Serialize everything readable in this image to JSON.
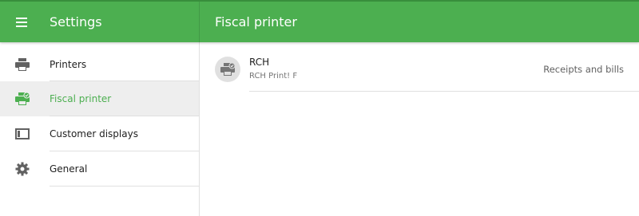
{
  "header": {
    "app_title": "Settings",
    "page_title": "Fiscal printer",
    "menu_icon": "menu-icon",
    "accent_color": "#4caf50"
  },
  "sidebar": {
    "items": [
      {
        "label": "Printers",
        "icon": "printer-icon",
        "active": false
      },
      {
        "label": "Fiscal printer",
        "icon": "fiscal-printer-icon",
        "active": true
      },
      {
        "label": "Customer displays",
        "icon": "display-icon",
        "active": false
      },
      {
        "label": "General",
        "icon": "gear-icon",
        "active": false
      }
    ]
  },
  "main": {
    "printers": [
      {
        "name": "RCH",
        "model": "RCH Print! F",
        "role": "Receipts and bills",
        "icon": "fiscal-printer-icon"
      }
    ]
  }
}
